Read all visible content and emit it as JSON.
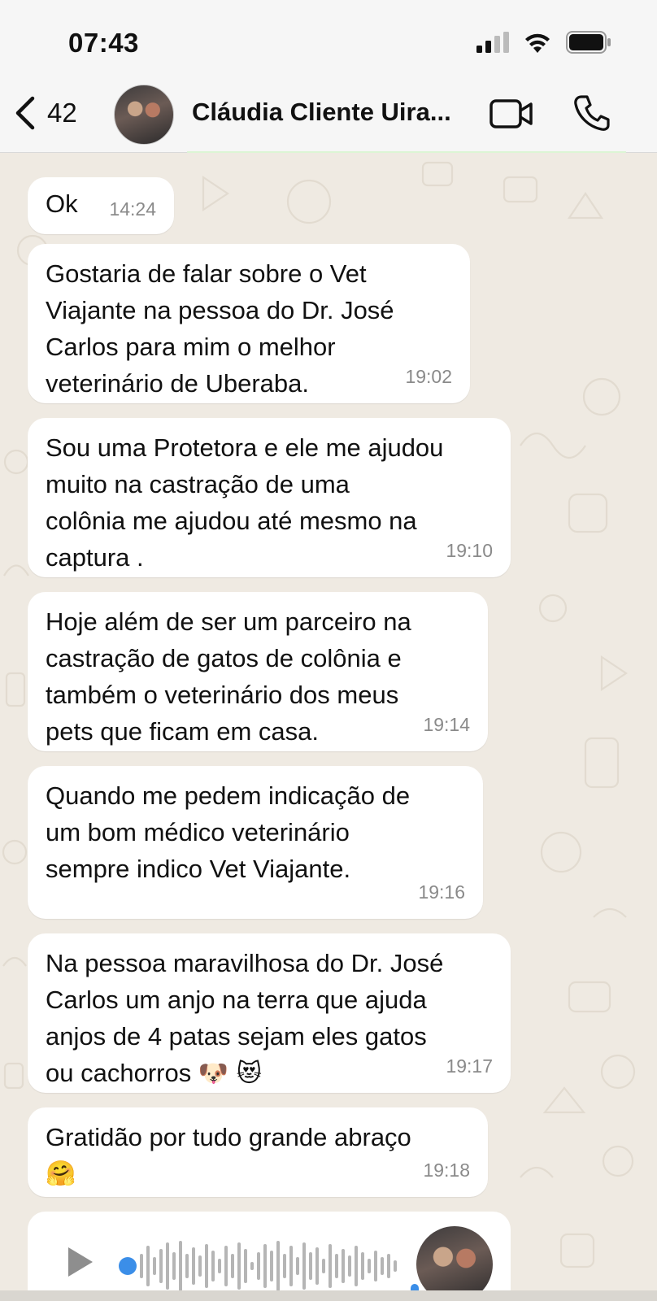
{
  "status_bar": {
    "time": "07:43"
  },
  "header": {
    "back_count": "42",
    "contact_name": "Cláudia Cliente Uira..."
  },
  "messages": [
    {
      "text": "Ok",
      "time": "14:24"
    },
    {
      "text": "Gostaria de falar sobre o Vet\nViajante na pessoa do  Dr. José\nCarlos para mim o melhor\nveterinário de Uberaba.",
      "time": "19:02"
    },
    {
      "text": "Sou uma Protetora e ele me ajudou\nmuito na castração  de uma\ncolônia me ajudou até mesmo na\ncaptura .",
      "time": "19:10"
    },
    {
      "text": "Hoje além de ser  um parceiro na\ncastração de gatos de colônia e\ntambém o veterinário dos meus\npets que ficam em casa.",
      "time": "19:14"
    },
    {
      "text": "Quando me pedem indicação de\num bom  médico veterinário\nsempre indico Vet Viajante.",
      "time": "19:16"
    },
    {
      "text": "Na pessoa maravilhosa do Dr. José\nCarlos  um anjo na terra que ajuda\nanjos de 4 patas sejam eles gatos\nou cachorros",
      "emojis": "🐶 😻",
      "time": "19:17"
    },
    {
      "text": "Gratidão por tudo grande abraço",
      "emojis": "🤗",
      "time": "19:18"
    }
  ],
  "icons": {
    "back": "chevron-left-icon",
    "video": "video-camera-icon",
    "call": "phone-icon",
    "signal": "signal-icon",
    "wifi": "wifi-icon",
    "battery": "battery-icon",
    "play": "play-icon",
    "mic": "microphone-icon"
  },
  "colors": {
    "chat_background": "#efeae2",
    "bubble": "#ffffff",
    "timestamp": "#8a8a8a",
    "voice_progress": "#3b8ee8"
  }
}
